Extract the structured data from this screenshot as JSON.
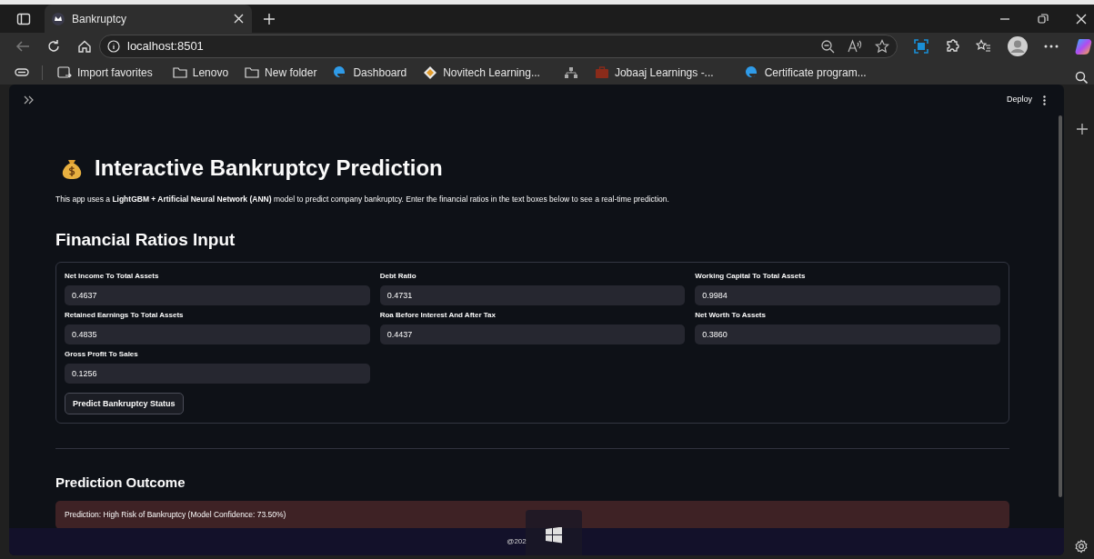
{
  "browser": {
    "tab": {
      "title": "Bankruptcy",
      "selected": true
    },
    "address": "localhost:8501",
    "bookmarks": [
      {
        "kind": "import",
        "label": "Import favorites"
      },
      {
        "kind": "folder",
        "label": "Lenovo"
      },
      {
        "kind": "folder",
        "label": "New folder"
      },
      {
        "kind": "edge",
        "label": "Dashboard"
      },
      {
        "kind": "diamond",
        "label": "Novitech Learning..."
      },
      {
        "kind": "network"
      },
      {
        "kind": "briefcase",
        "label": "Jobaaj Learnings -..."
      },
      {
        "kind": "edge",
        "label": "Certificate program..."
      }
    ]
  },
  "app": {
    "toolbar": {
      "deploy": "Deploy"
    },
    "title": "Interactive Bankruptcy Prediction",
    "description": "This app uses a **LightGBM + Artificial Neural Network (ANN)** model to predict company bankruptcy. Enter the financial ratios in the text boxes below to see a real-time prediction.",
    "form": {
      "heading": "Financial Ratios Input",
      "fields": [
        {
          "label": "Net Income To Total Assets",
          "value": "0.4637"
        },
        {
          "label": "Debt Ratio",
          "value": "0.4731"
        },
        {
          "label": "Working Capital To Total Assets",
          "value": "0.9984"
        },
        {
          "label": "Retained Earnings To Total Assets",
          "value": "0.4835"
        },
        {
          "label": "Roa Before Interest And After Tax",
          "value": "0.4437"
        },
        {
          "label": "Net Worth To Assets",
          "value": "0.3860"
        },
        {
          "label": "Gross Profit To Sales",
          "value": "0.1256"
        }
      ],
      "button": "Predict Bankruptcy Status"
    },
    "outcome": {
      "heading": "Prediction Outcome",
      "alert": {
        "kind": "error",
        "text": "Prediction: High Risk of Bankruptcy (Model Confidence: 73.50%)"
      }
    },
    "footer": "@202"
  }
}
